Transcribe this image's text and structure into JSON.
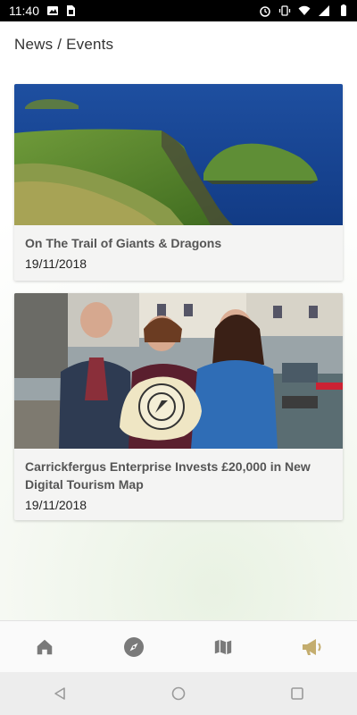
{
  "status_bar": {
    "time": "11:40",
    "left_icons": [
      "image-icon",
      "sim-icon"
    ],
    "right_icons": [
      "alarm-icon",
      "vibrate-icon",
      "wifi-icon",
      "signal-icon",
      "battery-icon"
    ]
  },
  "page": {
    "title": "News / Events"
  },
  "articles": [
    {
      "title": "On The Trail of Giants & Dragons",
      "date": "19/11/2018",
      "image": "coastal-cliffs-photo"
    },
    {
      "title": "Carrickfergus Enterprise Invests £20,000 in New Digital Tourism Map",
      "date": "19/11/2018",
      "image": "group-photo-harbour"
    }
  ],
  "bottom_nav": [
    {
      "name": "home",
      "icon": "home-icon",
      "active": false
    },
    {
      "name": "explore",
      "icon": "compass-icon",
      "active": false
    },
    {
      "name": "map",
      "icon": "map-icon",
      "active": false
    },
    {
      "name": "news",
      "icon": "megaphone-icon",
      "active": true
    }
  ],
  "colors": {
    "nav_inactive": "#7a7a7a",
    "nav_active": "#c4ad6e",
    "status_bar": "#000000",
    "card_bg": "#f4f4f3"
  }
}
